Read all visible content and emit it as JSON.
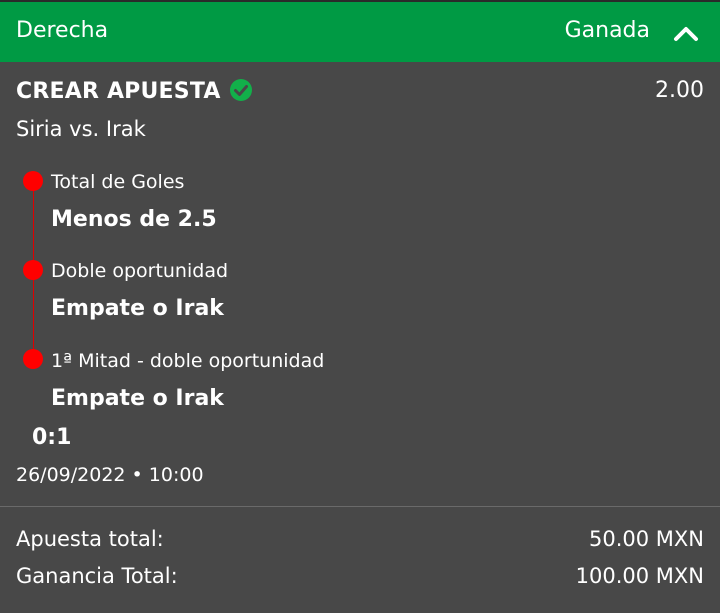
{
  "header": {
    "side": "Derecha",
    "status": "Ganada",
    "collapse_icon": "chevron-up-icon"
  },
  "bet": {
    "title": "CREAR APUESTA",
    "verified_icon": "check-circle-icon",
    "odds": "2.00",
    "match": "Siria vs. Irak",
    "legs": [
      {
        "market": "Total de Goles",
        "selection": "Menos de 2.5"
      },
      {
        "market": "Doble oportunidad",
        "selection": "Empate o Irak"
      },
      {
        "market": "1ª Mitad - doble oportunidad",
        "selection": "Empate o Irak"
      }
    ],
    "score": "0:1",
    "datetime": "26/09/2022 • 10:00"
  },
  "summary": {
    "stake_label": "Apuesta total:",
    "stake_value": "50.00 MXN",
    "win_label": "Ganancia Total:",
    "win_value": "100.00 MXN"
  },
  "colors": {
    "header_bg": "#009a44",
    "card_bg": "#484848",
    "timeline_red": "#ff0000",
    "check_green": "#12b04a"
  }
}
